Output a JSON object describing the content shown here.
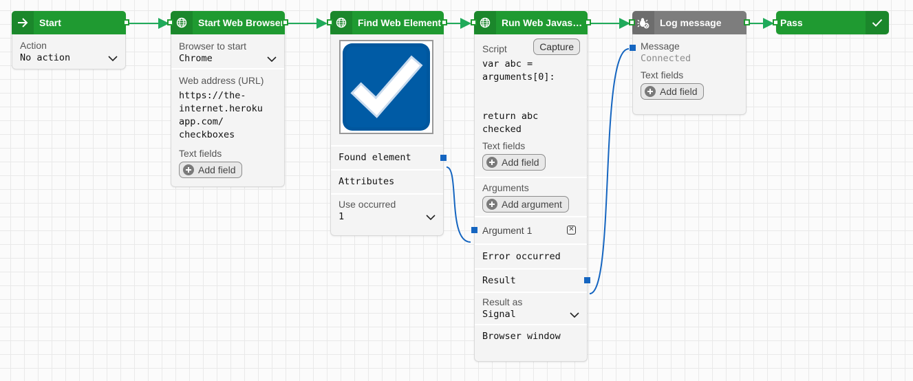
{
  "nodes": {
    "start": {
      "title": "Start",
      "action_label": "Action",
      "action_value": "No action"
    },
    "browser": {
      "title": "Start Web Browser",
      "browser_label": "Browser to start",
      "browser_value": "Chrome",
      "url_label": "Web address (URL)",
      "url_lines": [
        "https://the-",
        "internet.heroku",
        "app.com/",
        "checkboxes"
      ],
      "text_fields_label": "Text fields",
      "add_field_label": "Add field"
    },
    "find": {
      "title": "Find Web Element",
      "found_label": "Found element",
      "attributes_label": "Attributes",
      "use_label": "Use occurred",
      "use_value": "1"
    },
    "script": {
      "title": "Run Web Javascr...",
      "script_label": "Script",
      "capture_label": "Capture",
      "script_lines": [
        "var abc =",
        "arguments[0]:",
        "",
        "",
        "return abc",
        "checked"
      ],
      "text_fields_label": "Text fields",
      "add_field_label": "Add field",
      "arguments_label": "Arguments",
      "add_argument_label": "Add argument",
      "argument1_label": "Argument 1",
      "error_label": "Error occurred",
      "result_label": "Result",
      "result_as_label": "Result as",
      "result_as_value": "Signal",
      "browser_window_label": "Browser window"
    },
    "log": {
      "title": "Log message",
      "message_label": "Message",
      "message_value": "Connected",
      "text_fields_label": "Text fields",
      "add_field_label": "Add field"
    },
    "pass": {
      "title": "Pass"
    }
  },
  "colors": {
    "header_green": "#1f9a31",
    "header_gray": "#7d7d7d",
    "flow_wire": "#1faa5a",
    "data_wire": "#1565c0",
    "check_blue": "#00579e"
  },
  "icons": [
    "arrow-right-icon",
    "globe-icon",
    "bug-icon",
    "check-icon",
    "chevron-down-icon",
    "plus-icon",
    "close-icon"
  ]
}
